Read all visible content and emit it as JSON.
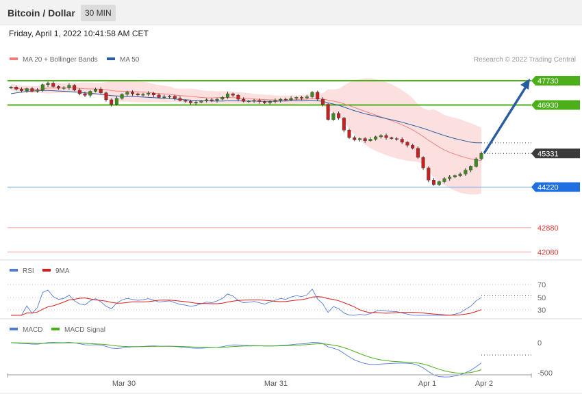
{
  "header": {
    "title": "Bitcoin / Dollar",
    "timeframe": "30 MIN",
    "datetime": "Friday, April 1, 2022 10:41:58 AM CET"
  },
  "price_panel": {
    "legend": [
      {
        "label": "MA 20 + Bollinger Bands",
        "color": "#f08080"
      },
      {
        "label": "MA 50",
        "color": "#2a5d9f"
      }
    ],
    "credit": "Research © 2022 Trading Central",
    "levels": [
      {
        "label": "47730",
        "kind": "resistance",
        "color": "#4caf1a"
      },
      {
        "label": "46930",
        "kind": "resistance",
        "color": "#4caf1a"
      },
      {
        "label": "45331",
        "kind": "last",
        "color": "#3a3a3a"
      },
      {
        "label": "44220",
        "kind": "pivot",
        "color": "#1f6fe0"
      },
      {
        "label": "42880",
        "kind": "support",
        "color": "#e53935"
      },
      {
        "label": "42080",
        "kind": "support",
        "color": "#e53935"
      }
    ]
  },
  "rsi_panel": {
    "legend": [
      {
        "label": "RSI",
        "color": "#4f7ad8"
      },
      {
        "label": "9MA",
        "color": "#d81b1b"
      }
    ],
    "ticks": [
      "70",
      "50",
      "30"
    ]
  },
  "macd_panel": {
    "legend": [
      {
        "label": "MACD",
        "color": "#4f7ad8"
      },
      {
        "label": "MACD Signal",
        "color": "#4caf1a"
      }
    ],
    "ticks": [
      "0",
      "-500"
    ]
  },
  "x_axis": {
    "ticks": [
      "Mar 30",
      "Mar 31",
      "Apr 1",
      "Apr 2"
    ]
  },
  "chart_data": {
    "type": "line",
    "title": "Bitcoin / Dollar",
    "timeframe": "30 MIN",
    "price_levels": [
      47730,
      46930,
      45331,
      44220,
      42880,
      42080
    ],
    "close": [
      47520,
      47450,
      47400,
      47470,
      47380,
      47420,
      47600,
      47650,
      47540,
      47480,
      47500,
      47580,
      47420,
      47300,
      47250,
      47380,
      47450,
      47330,
      47100,
      46950,
      47150,
      47280,
      47350,
      47300,
      47260,
      47280,
      47320,
      47260,
      47180,
      47200,
      47220,
      47150,
      47080,
      47050,
      47000,
      47020,
      47060,
      47100,
      47080,
      47120,
      47180,
      47300,
      47250,
      47120,
      47050,
      47060,
      47080,
      47040,
      47000,
      47040,
      47080,
      47120,
      47100,
      47150,
      47180,
      47160,
      47200,
      47350,
      47120,
      46950,
      46450,
      46650,
      46500,
      46100,
      45850,
      45780,
      45820,
      45750,
      45800,
      45880,
      45920,
      45850,
      45820,
      45800,
      45700,
      45600,
      45500,
      45200,
      44850,
      44450,
      44300,
      44400,
      44500,
      44550,
      44600,
      44650,
      44780,
      44900,
      45150,
      45331
    ],
    "ma50": [
      47300,
      47330,
      47350,
      47380,
      47390,
      47400,
      47410,
      47410,
      47400,
      47390,
      47380,
      47370,
      47360,
      47350,
      47330,
      47320,
      47300,
      47280,
      47260,
      47240,
      47230,
      47220,
      47210,
      47210,
      47200,
      47190,
      47180,
      47170,
      47160,
      47150,
      47140,
      47130,
      47110,
      47100,
      47090,
      47080,
      47070,
      47070,
      47060,
      47060,
      47060,
      47070,
      47070,
      47070,
      47060,
      47060,
      47060,
      47050,
      47050,
      47050,
      47050,
      47060,
      47060,
      47070,
      47070,
      47070,
      47080,
      47080,
      47070,
      47050,
      47000,
      46960,
      46920,
      46860,
      46800,
      46740,
      46690,
      46640,
      46600,
      46560,
      46520,
      46480,
      46440,
      46400,
      46360,
      46310,
      46260,
      46210,
      46160,
      46100,
      46040,
      45980,
      45920,
      45870,
      45820,
      45780,
      45740,
      45700,
      45680,
      45680
    ],
    "rsi_range": [
      30,
      70
    ],
    "macd_range": [
      -500,
      0
    ],
    "x_labels": [
      "Mar 30",
      "Mar 31",
      "Apr 1",
      "Apr 2"
    ]
  }
}
